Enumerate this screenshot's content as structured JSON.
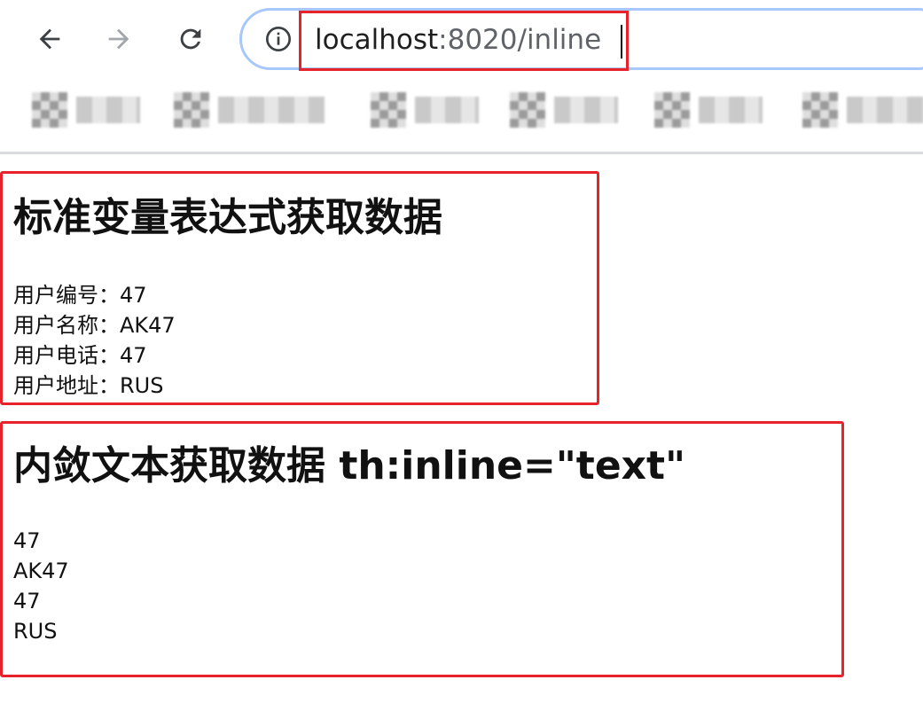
{
  "browser": {
    "url_host": "localhost",
    "url_rest": ":8020/inline",
    "back_icon": "arrow-left-icon",
    "forward_icon": "arrow-right-icon",
    "reload_icon": "reload-icon",
    "info_icon": "info-icon"
  },
  "page": {
    "section1": {
      "title": "标准变量表达式获取数据",
      "lines": [
        "用户编号：47",
        "用户名称：AK47",
        "用户电话：47",
        "用户地址：RUS"
      ]
    },
    "section2": {
      "title": "内敛文本获取数据 th:inline=\"text\"",
      "lines": [
        "47",
        "AK47",
        "47",
        "RUS"
      ]
    }
  },
  "colors": {
    "highlight_border": "#e8222a",
    "omnibox_border": "#a8c7fa"
  }
}
